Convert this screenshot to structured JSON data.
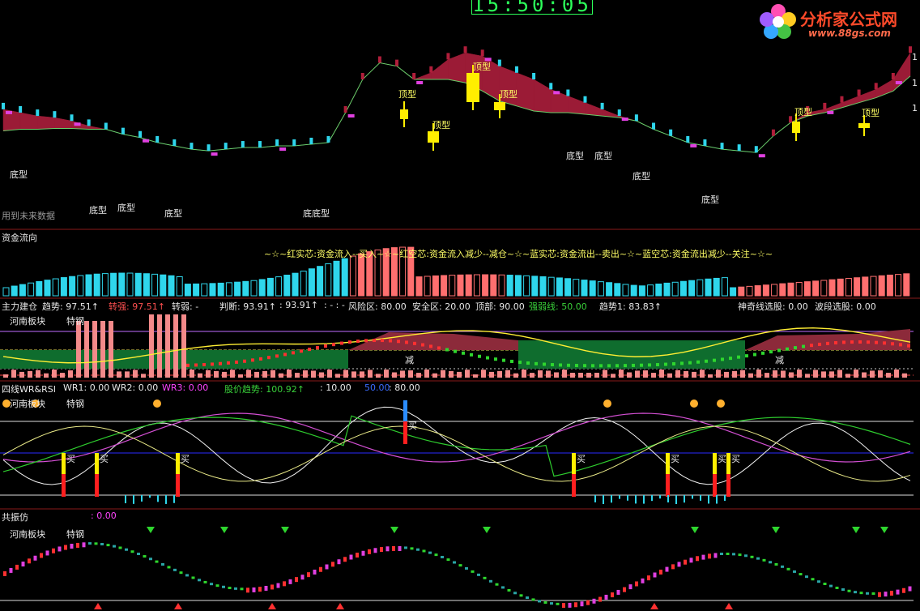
{
  "header": {
    "clock": "15:50:05",
    "logo_text": "分析家公式网",
    "logo_url": "www.88gs.com"
  },
  "main": {
    "future_data_note": "用到未来数据",
    "top_labels": [
      "顶型",
      "顶型",
      "顶型",
      "顶型",
      "顶型",
      "顶型"
    ],
    "bottom_labels": [
      "底型",
      "底型",
      "底型",
      "底型",
      "底底型",
      "底型",
      "底型",
      "底型",
      "底型"
    ],
    "right_axis": [
      "1",
      "1",
      "1"
    ]
  },
  "flow": {
    "title": "资金流向",
    "legend": "~☆~红实芯:资金流入--买入~☆~红空芯:资金流入减少--减仓~☆~蓝实芯:资金流出--卖出~☆~蓝空芯:资金流出减少--关注~☆~"
  },
  "build": {
    "title": "主力建仓",
    "fields": [
      {
        "text": "趋势: 97.51↑",
        "color": "w"
      },
      {
        "text": "转强: 97.51↑",
        "color": "r"
      },
      {
        "text": "转弱: -",
        "color": "w"
      },
      {
        "text": "判断: 93.91↑",
        "color": "w"
      },
      {
        "text": ": 93.91↑",
        "color": "w"
      },
      {
        "text": ": - : -",
        "color": "w"
      },
      {
        "text": "风险区: 80.00",
        "color": "w"
      },
      {
        "text": "安全区: 20.00",
        "color": "w"
      },
      {
        "text": "顶部: 90.00",
        "color": "w"
      },
      {
        "text": "强弱线: 50.00",
        "color": "g"
      },
      {
        "text": "趋势1: 83.83↑",
        "color": "w"
      },
      {
        "text": "神奇线选股: 0.00",
        "color": "w"
      },
      {
        "text": "波段选股: 0.00",
        "color": "w"
      }
    ],
    "sector": "河南板块",
    "stock": "特钢",
    "reduce_labels": [
      "减",
      "减"
    ]
  },
  "wr": {
    "title": "四线WR&RSI",
    "fields": [
      {
        "text": "WR1: 0.00",
        "color": "w"
      },
      {
        "text": "WR2: 0.00",
        "color": "w"
      },
      {
        "text": "WR3: 0.00",
        "color": "m"
      },
      {
        "text": "股价趋势: 100.92↑",
        "color": "g"
      },
      {
        "text": ": 10.00",
        "color": "w"
      },
      {
        "text": "50.00",
        "color": "b"
      },
      {
        "text": ": 80.00",
        "color": "w"
      }
    ],
    "sector": "河南板块",
    "stock": "特钢",
    "buy_labels": [
      "买",
      "买",
      "买",
      "买",
      "买",
      "买",
      "买",
      "买"
    ]
  },
  "resonance": {
    "title": "共振仿",
    "value": ": 0.00",
    "sector": "河南板块",
    "stock": "特钢"
  },
  "colors": {
    "bull": "#9b1b36",
    "bear": "#1e7fd6",
    "cyan": "#2fd6ec",
    "salmon": "#ff6f6f",
    "yellow": "#ffee00",
    "magenta": "#e040e0",
    "green": "#2eb82e"
  },
  "chart_data": {
    "type": "area",
    "panels": [
      "主图",
      "资金流向",
      "主力建仓",
      "四线WR&RSI",
      "共振仿"
    ],
    "series": [
      {
        "values": [
          62,
          60,
          58,
          57,
          55,
          52,
          50,
          47,
          45,
          42,
          40,
          38,
          37,
          38,
          39,
          39,
          40,
          40,
          41,
          42,
          60,
          80,
          90,
          88,
          80,
          84,
          92,
          96,
          94,
          88,
          84,
          80,
          74,
          70,
          66,
          62,
          58,
          55,
          50,
          46,
          42,
          40,
          38,
          37,
          36,
          46,
          54,
          60,
          62,
          66,
          70,
          74,
          80,
          96
        ]
      },
      {
        "values": [
          20,
          24,
          26,
          28,
          30,
          32,
          34,
          36,
          33,
          30,
          26,
          22,
          24,
          26,
          28,
          28,
          26,
          24,
          30,
          40,
          60,
          80,
          86,
          82,
          70,
          60,
          52,
          44,
          36,
          30,
          28,
          26,
          30,
          34,
          36,
          38,
          40,
          42,
          40,
          38,
          34,
          30,
          26,
          28,
          30,
          34,
          38,
          40,
          42,
          44,
          46,
          48,
          50,
          52
        ]
      }
    ]
  }
}
